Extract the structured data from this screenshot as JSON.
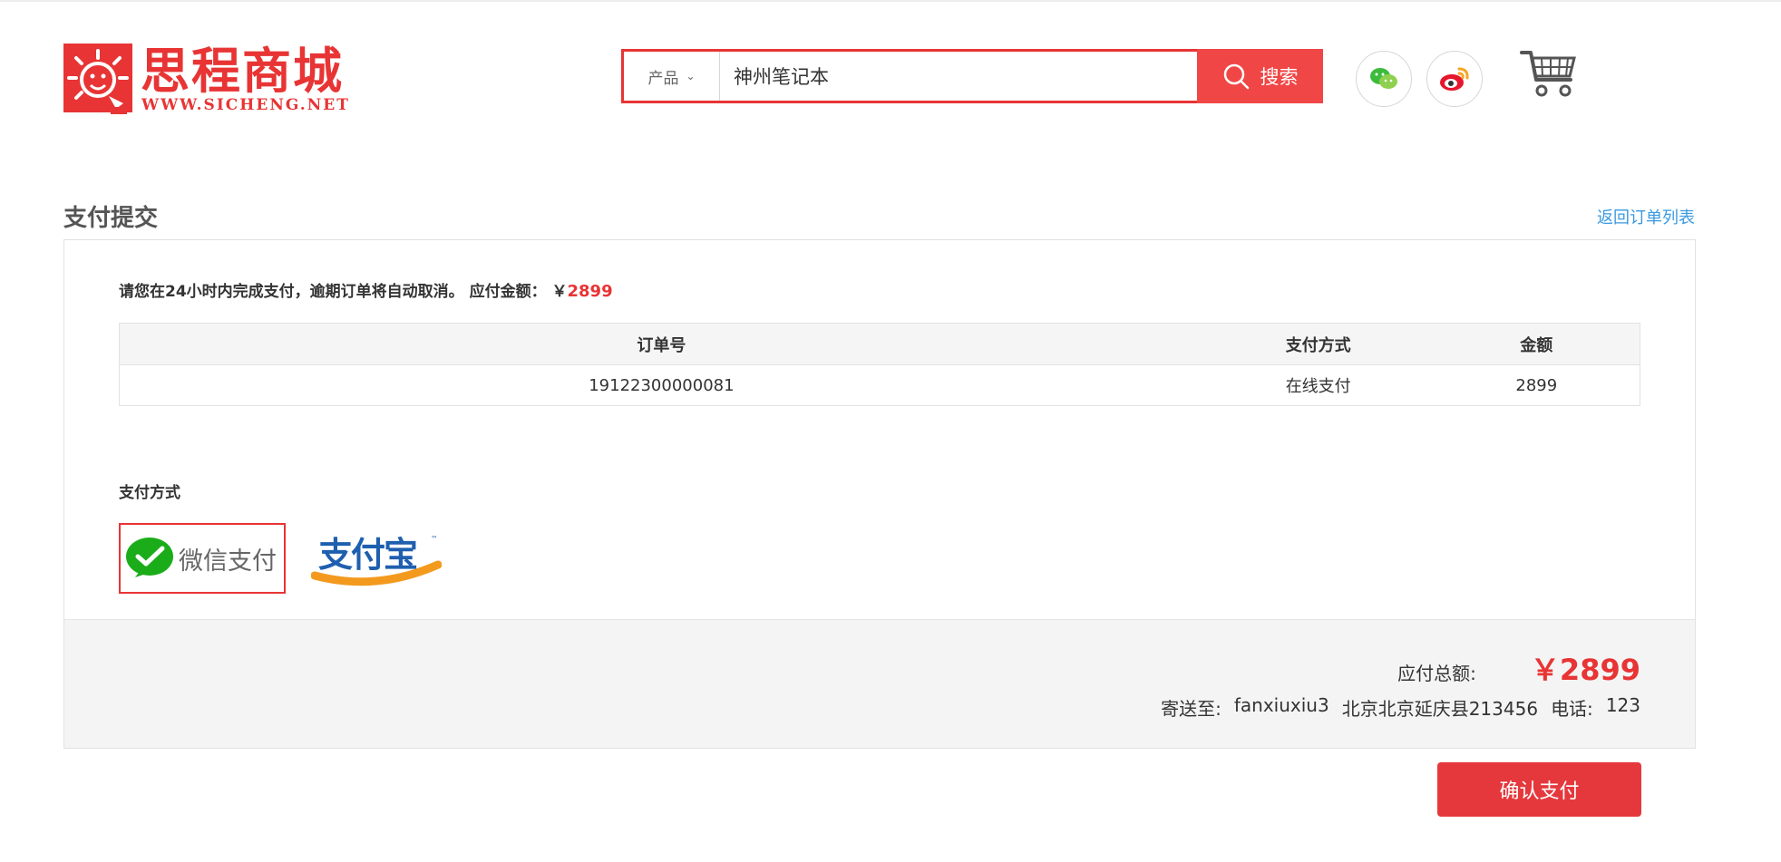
{
  "brand": {
    "name": "思程商城",
    "domain": "WWW.SICHENG.NET",
    "color": "#e83434"
  },
  "search": {
    "category": "产品",
    "query": "神州笔记本",
    "button_label": "搜索",
    "icon": "search-icon"
  },
  "social": {
    "wechat_icon": "wechat-icon",
    "weibo_icon": "weibo-icon"
  },
  "cart": {
    "icon": "shopping-cart-icon"
  },
  "page": {
    "title": "支付提交",
    "back_link": "返回订单列表"
  },
  "notice": {
    "text": "请您在24小时内完成支付，逾期订单将自动取消。 应付金额：",
    "currency": "￥",
    "amount": "2899"
  },
  "order_table": {
    "headers": [
      "订单号",
      "支付方式",
      "金额"
    ],
    "rows": [
      {
        "order_no": "19122300000081",
        "method": "在线支付",
        "amount": "2899"
      }
    ]
  },
  "payment": {
    "label": "支付方式",
    "wechat_label": "微信支付",
    "alipay_label": "支付宝",
    "selected": "wechat"
  },
  "summary": {
    "total_label": "应付总额:",
    "total_value": "￥2899",
    "ship_label": "寄送至:",
    "ship_name": "fanxiuxiu3",
    "ship_address": "北京北京延庆县213456",
    "phone_label": "电话:",
    "phone": "123"
  },
  "confirm_button": "确认支付",
  "colors": {
    "accent": "#e83434",
    "link": "#3a9ae0",
    "wechat_green": "#1aad19",
    "alipay_blue": "#1f5faf",
    "alipay_orange": "#f39a1e"
  }
}
